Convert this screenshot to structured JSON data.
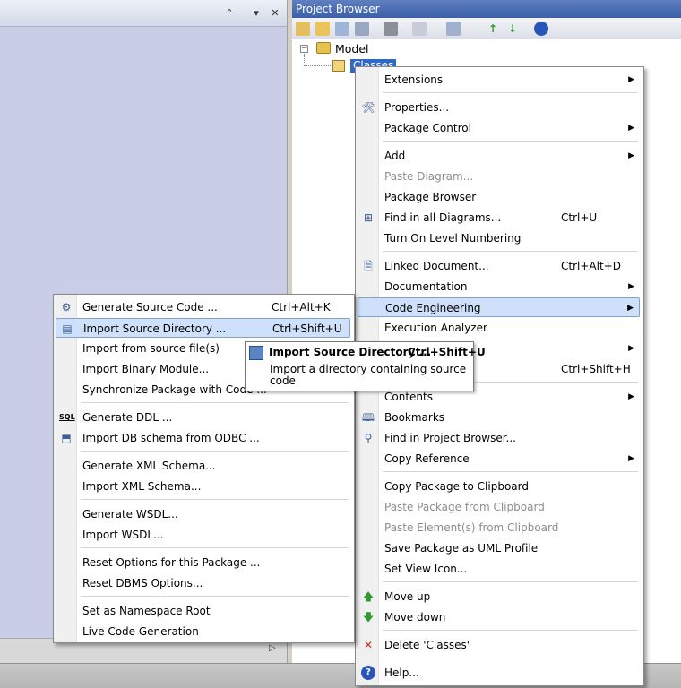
{
  "browser": {
    "title": "Project Browser"
  },
  "tree": {
    "root": "Model",
    "selected": "Classes"
  },
  "main_menu": [
    {
      "label": "Extensions",
      "arrow": true
    },
    {
      "label": "Properties...",
      "icon": "properties-icon"
    },
    {
      "label": "Package Control",
      "arrow": true
    },
    {
      "label": "Add",
      "arrow": true
    },
    {
      "label": "Paste Diagram...",
      "disabled": true
    },
    {
      "label": "Package Browser"
    },
    {
      "label": "Find in all Diagrams...",
      "shortcut": "Ctrl+U",
      "icon": "find-diagrams-icon"
    },
    {
      "label": "Turn On Level Numbering"
    },
    {
      "label": "Linked Document...",
      "shortcut": "Ctrl+Alt+D",
      "icon": "linked-document-icon"
    },
    {
      "label": "Documentation",
      "arrow": true
    },
    {
      "label": "Code Engineering",
      "arrow": true
    },
    {
      "label": "Execution Analyzer"
    },
    {
      "label": "",
      "arrow": true
    },
    {
      "label": "ackage",
      "shortcut": "Ctrl+Shift+H"
    },
    {
      "label": "Contents",
      "arrow": true
    },
    {
      "label": "Bookmarks",
      "icon": "bookmarks-icon"
    },
    {
      "label": "Find in Project Browser...",
      "icon": "binoculars-icon"
    },
    {
      "label": "Copy Reference",
      "arrow": true
    },
    {
      "label": "Copy Package to Clipboard"
    },
    {
      "label": "Paste Package from Clipboard",
      "disabled": true
    },
    {
      "label": "Paste Element(s) from Clipboard",
      "disabled": true
    },
    {
      "label": "Save Package as UML Profile"
    },
    {
      "label": "Set View Icon..."
    },
    {
      "label": "Move up",
      "icon": "up-arrow-icon"
    },
    {
      "label": "Move down",
      "icon": "down-arrow-icon"
    },
    {
      "label": "Delete 'Classes'",
      "icon": "delete-icon"
    },
    {
      "label": "Help...",
      "icon": "help-icon"
    }
  ],
  "sub_menu": [
    {
      "label": "Generate Source Code ...",
      "shortcut": "Ctrl+Alt+K",
      "icon": "generate-code-icon"
    },
    {
      "label": "Import Source Directory ...",
      "shortcut": "Ctrl+Shift+U",
      "icon": "import-directory-icon"
    },
    {
      "label": "Import from source file(s)"
    },
    {
      "label": "Import Binary Module..."
    },
    {
      "label": "Synchronize Package with Code ..."
    },
    {
      "label": "Generate DDL ...",
      "icon": "sql-icon"
    },
    {
      "label": "Import DB schema from ODBC ...",
      "icon": "db-import-icon"
    },
    {
      "label": "Generate XML Schema..."
    },
    {
      "label": "Import XML Schema..."
    },
    {
      "label": "Generate WSDL..."
    },
    {
      "label": "Import WSDL..."
    },
    {
      "label": "Reset Options for this Package ..."
    },
    {
      "label": "Reset DBMS Options..."
    },
    {
      "label": "Set as Namespace Root"
    },
    {
      "label": "Live Code Generation"
    }
  ],
  "tooltip": {
    "title": "Import Source Directory ...",
    "shortcut": "Ctrl+Shift+U",
    "description": "Import a directory containing source code"
  },
  "glyphs": {
    "arrow": "▶",
    "properties-icon": "🛠",
    "find-diagrams-icon": "⊞",
    "linked-document-icon": "🗎",
    "bookmarks-icon": "🕮",
    "binoculars-icon": "⚲",
    "up-arrow-icon": "🡅",
    "down-arrow-icon": "🡇",
    "delete-icon": "✕",
    "help-icon": "?",
    "generate-code-icon": "⚙",
    "import-directory-icon": "▤",
    "sql-icon": "SQL",
    "db-import-icon": "⬒"
  },
  "colors": {
    "delete": "#cc2a1c",
    "up": "#2f9a2f",
    "down": "#2f9a2f",
    "help": "#2a55b8"
  }
}
